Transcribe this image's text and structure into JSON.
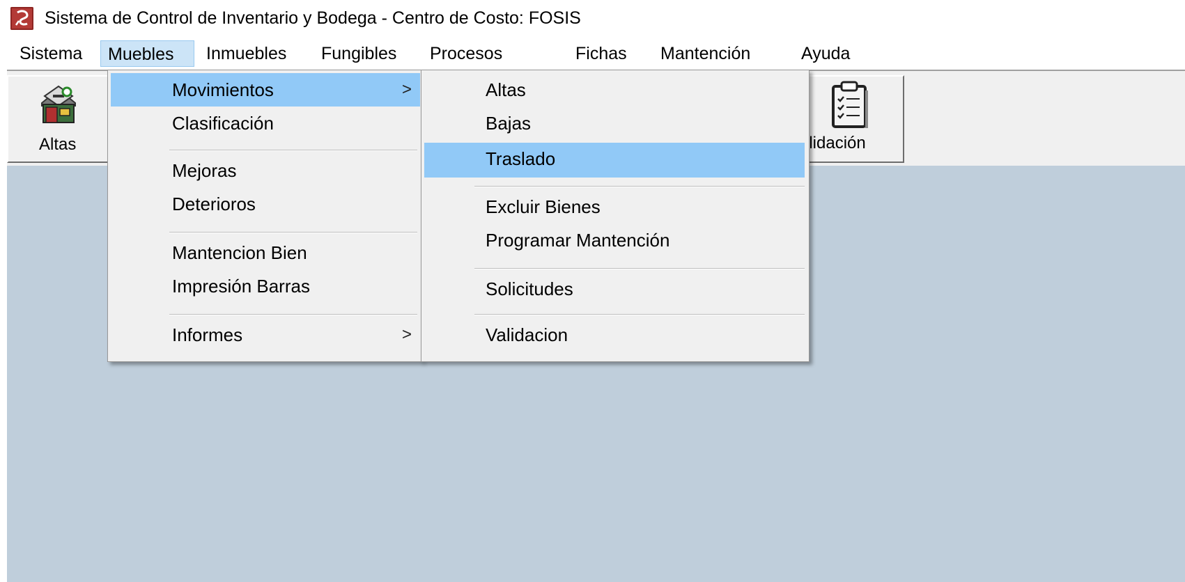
{
  "window": {
    "title": "Sistema de Control de Inventario y Bodega - Centro de Costo: FOSIS",
    "icon": "app-logo-icon"
  },
  "menubar": {
    "items": [
      {
        "label": "Sistema"
      },
      {
        "label": "Muebles",
        "active": true
      },
      {
        "label": "Inmuebles"
      },
      {
        "label": "Fungibles"
      },
      {
        "label": "Procesos"
      },
      {
        "label": "Fichas"
      },
      {
        "label": "Mantención"
      },
      {
        "label": "Ayuda"
      }
    ]
  },
  "toolbar": {
    "buttons": [
      {
        "label": "Altas",
        "icon": "house-icon"
      },
      {
        "label": "Validación",
        "icon": "clipboard-checklist-icon",
        "visible_text": "alidación"
      }
    ]
  },
  "muebles_menu": {
    "items": [
      {
        "label": "Movimientos",
        "submenu_arrow": ">",
        "highlighted": true
      },
      {
        "label": "Clasificación"
      },
      {
        "label": "Mejoras"
      },
      {
        "label": "Deterioros"
      },
      {
        "label": "Mantencion Bien"
      },
      {
        "label": "Impresión Barras"
      },
      {
        "label": "Informes",
        "submenu_arrow": ">"
      }
    ]
  },
  "movimientos_submenu": {
    "items": [
      {
        "label": "Altas"
      },
      {
        "label": "Bajas"
      },
      {
        "label": "Traslado",
        "highlighted": true
      },
      {
        "label": "Excluir Bienes"
      },
      {
        "label": "Programar Mantención"
      },
      {
        "label": "Solicitudes"
      },
      {
        "label": "Validacion"
      }
    ]
  },
  "colors": {
    "menu_highlight": "#91c9f7",
    "menubar_active": "#cce4f7",
    "client_background": "#bfcedb",
    "app_icon": "#b33a36"
  }
}
